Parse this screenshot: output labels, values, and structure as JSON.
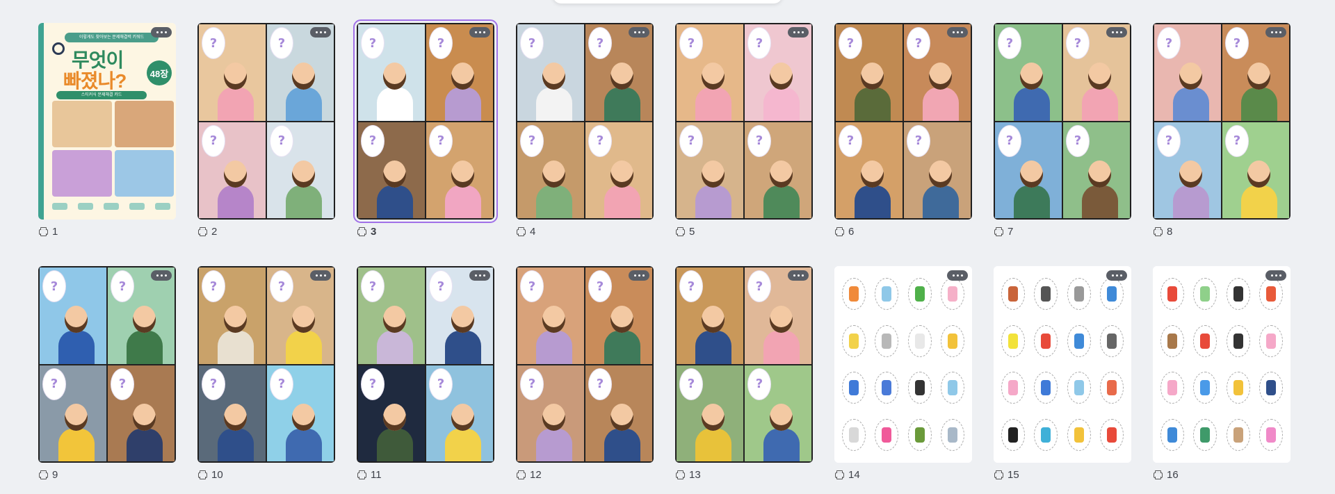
{
  "pages": [
    {
      "number": "1",
      "kind": "cover",
      "cover": {
        "subtitle": "이렇게도 찾아보는 문제해결력 키워드",
        "title_line1": "무엇이",
        "title_line2": "빠졌나?",
        "badge": "48장",
        "strip": "스티커식 문제해결 카드"
      },
      "colors": [
        "#e8c69a",
        "#d9a77a",
        "#c9a0d8",
        "#9cc7e6"
      ]
    },
    {
      "number": "2",
      "kind": "quad",
      "colors": [
        "#e9c79e",
        "#c9d8de",
        "#e8c2c8",
        "#d9e3ea"
      ],
      "body": [
        "#f2a4b3",
        "#6aa6d9",
        "#b685c9",
        "#7fb07a"
      ]
    },
    {
      "number": "3",
      "kind": "quad",
      "selected": true,
      "colors": [
        "#cfe2ea",
        "#c98c4f",
        "#8d6a4b",
        "#d3a36e"
      ],
      "body": [
        "#ffffff",
        "#b79bd0",
        "#2f4f8a",
        "#f1a6c2"
      ]
    },
    {
      "number": "4",
      "kind": "quad",
      "colors": [
        "#c9d6df",
        "#b8865a",
        "#c59a6a",
        "#e0b98b"
      ],
      "body": [
        "#f3f3f3",
        "#3f7a5a",
        "#7fb07a",
        "#f2a4b3"
      ]
    },
    {
      "number": "5",
      "kind": "quad",
      "colors": [
        "#e6b889",
        "#efc7d0",
        "#d6b48c",
        "#cfa67a"
      ],
      "body": [
        "#f2a4b3",
        "#f5b7cf",
        "#b79bd0",
        "#4f8a5a"
      ]
    },
    {
      "number": "6",
      "kind": "quad",
      "colors": [
        "#c08a52",
        "#c78a5a",
        "#d4a068",
        "#c9a27a"
      ],
      "body": [
        "#5a6b3a",
        "#f1a6b3",
        "#2f4f8a",
        "#3f6a9a"
      ]
    },
    {
      "number": "7",
      "kind": "quad",
      "colors": [
        "#8cc08a",
        "#e5c39a",
        "#7fb0d8",
        "#8fbf8a"
      ],
      "body": [
        "#3f6ab0",
        "#f2a4b3",
        "#3d7a5a",
        "#7a5a3a"
      ]
    },
    {
      "number": "8",
      "kind": "quad",
      "colors": [
        "#e9b7b0",
        "#c98c5a",
        "#9fc6e2",
        "#9fd08f"
      ],
      "body": [
        "#6a8ed0",
        "#5a8a4a",
        "#b79bd0",
        "#f2d24a"
      ]
    },
    {
      "number": "9",
      "kind": "quad",
      "colors": [
        "#8fc7e8",
        "#9fd0b0",
        "#8a9aa8",
        "#a97a52"
      ],
      "body": [
        "#2f5fb0",
        "#3f7a4a",
        "#f2c53a",
        "#2f3f6a"
      ]
    },
    {
      "number": "10",
      "kind": "quad",
      "colors": [
        "#c9a26a",
        "#d8b58a",
        "#5a6a7a",
        "#8fd0e8"
      ],
      "body": [
        "#e8e0d0",
        "#f2d24a",
        "#2f4f8a",
        "#3f6ab0"
      ]
    },
    {
      "number": "11",
      "kind": "quad",
      "colors": [
        "#9fc08a",
        "#d8e4ee",
        "#1f2a3f",
        "#8fc2de"
      ],
      "body": [
        "#c9b7d8",
        "#2f4f8a",
        "#3f5a3a",
        "#f2d24a"
      ]
    },
    {
      "number": "12",
      "kind": "quad",
      "colors": [
        "#d8a27a",
        "#c98c5a",
        "#c99a7a",
        "#b8865a"
      ],
      "body": [
        "#b79bd0",
        "#3f7a5a",
        "#b79bd0",
        "#2f4f8a"
      ]
    },
    {
      "number": "13",
      "kind": "quad",
      "colors": [
        "#c9985a",
        "#e0b898",
        "#8fb07a",
        "#9fc88a"
      ],
      "body": [
        "#2f4f8a",
        "#f2a4b3",
        "#e8c23a",
        "#3f6ab0"
      ]
    },
    {
      "number": "14",
      "kind": "icons",
      "icons": [
        "#f08a3a",
        "#8fc8e8",
        "#4fb04a",
        "#f5b0c8",
        "#f2d24a",
        "#b8b8b8",
        "#e8e8e8",
        "#f2c23a",
        "#3f7ad8",
        "#4a7ad8",
        "#333333",
        "#8fc8e8",
        "#d8d8d8",
        "#f05a9a",
        "#6a9a3a",
        "#a8b8c8"
      ]
    },
    {
      "number": "15",
      "kind": "icons",
      "icons": [
        "#c9643a",
        "#555555",
        "#999999",
        "#3f8ad8",
        "#f2e23a",
        "#e84a3a",
        "#3f8ad8",
        "#666666",
        "#f5a8c8",
        "#3f7ad8",
        "#8fc8e8",
        "#e86a4a",
        "#222222",
        "#3fb0d8",
        "#f2c23a",
        "#e84a3a"
      ]
    },
    {
      "number": "16",
      "kind": "icons",
      "icons": [
        "#e84a3a",
        "#8fd08a",
        "#333333",
        "#e85a3a",
        "#a8784a",
        "#e84a3a",
        "#333333",
        "#f5a8c8",
        "#f5a8c8",
        "#4a9ae8",
        "#f2c23a",
        "#2f4f8a",
        "#3f8ad8",
        "#3f9a6a",
        "#c9a27a",
        "#f08ac8"
      ]
    }
  ]
}
